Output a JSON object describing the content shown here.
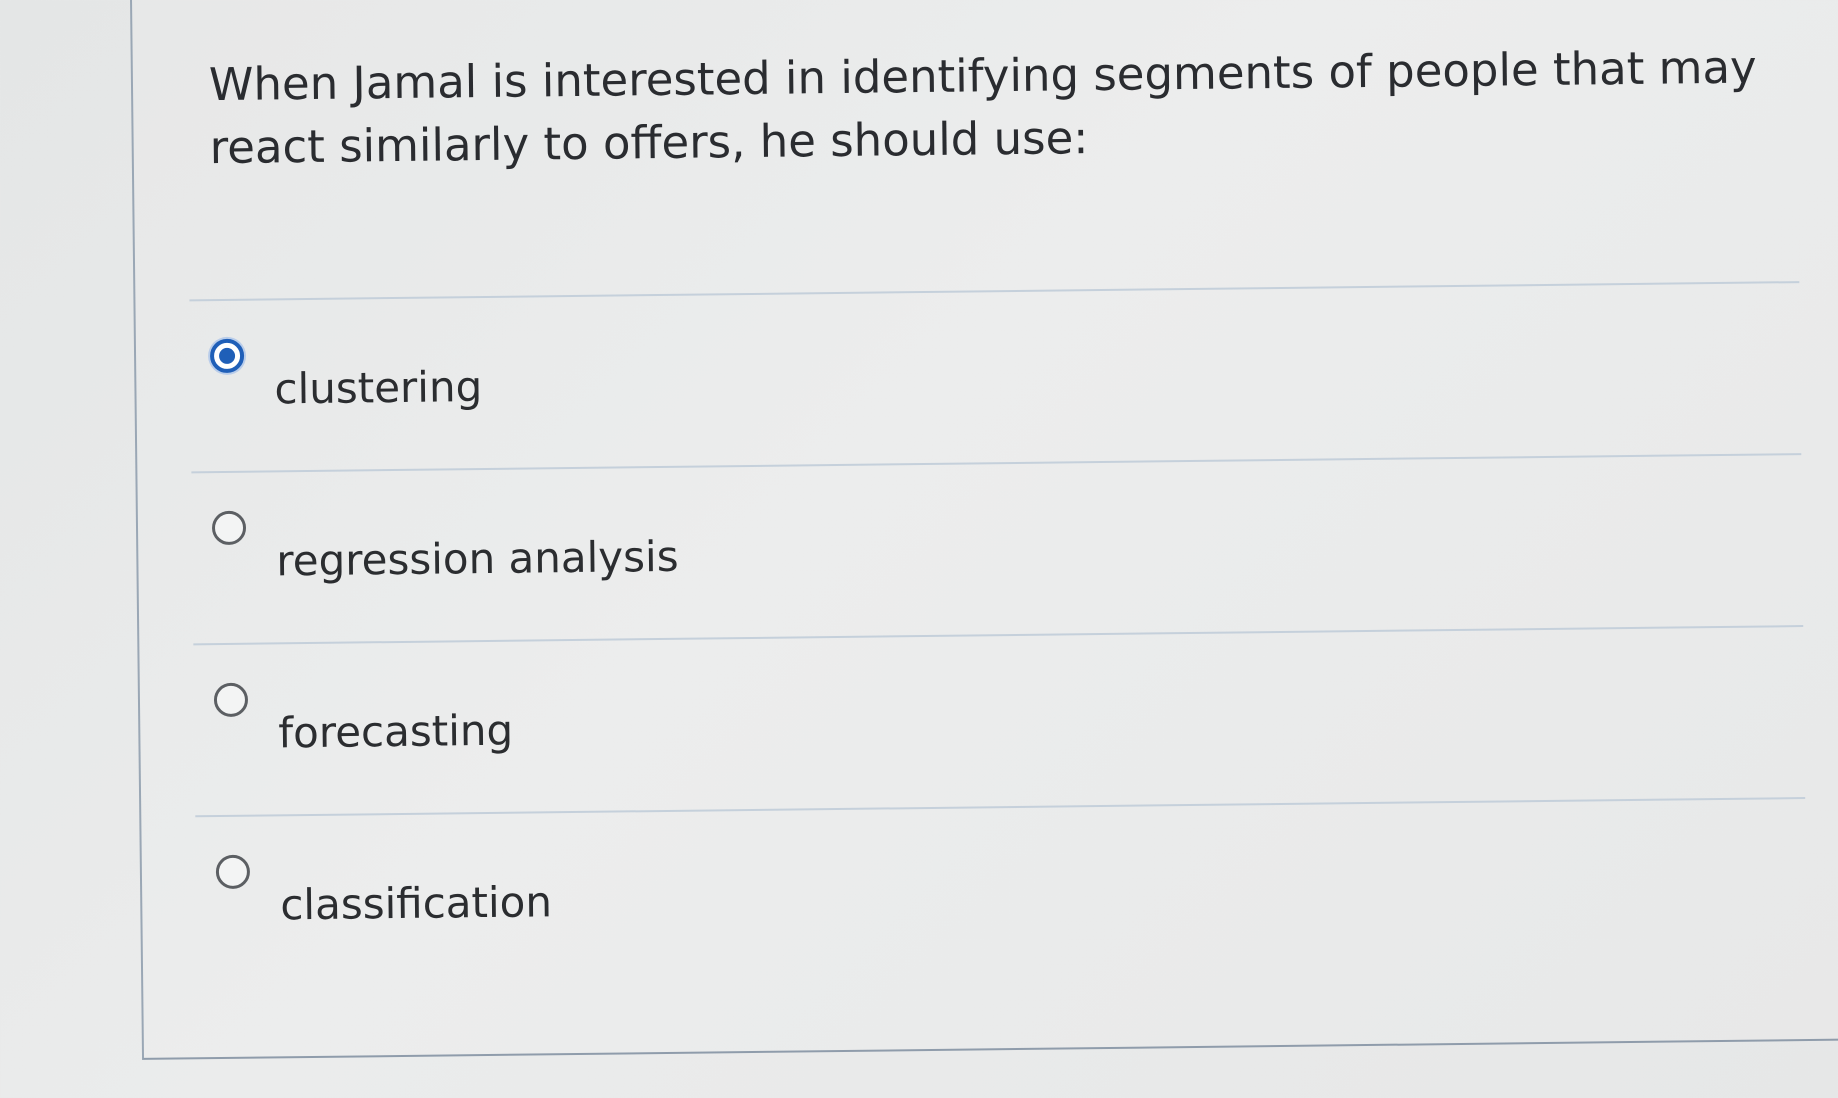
{
  "question": {
    "text": "When Jamal is interested in identifying segments of people that may react similarly to offers, he should use:"
  },
  "answers": [
    {
      "label": "clustering",
      "selected": true
    },
    {
      "label": "regression analysis",
      "selected": false
    },
    {
      "label": "forecasting",
      "selected": false
    },
    {
      "label": "classification",
      "selected": false
    }
  ],
  "colors": {
    "accent": "#1f5fb8",
    "text": "#2b2d30",
    "divider": "#c5d0db",
    "background": "#e8e9e9"
  },
  "icons": {
    "selected_radio": "radio-selected-icon",
    "unselected_radio": "radio-unselected-icon"
  }
}
